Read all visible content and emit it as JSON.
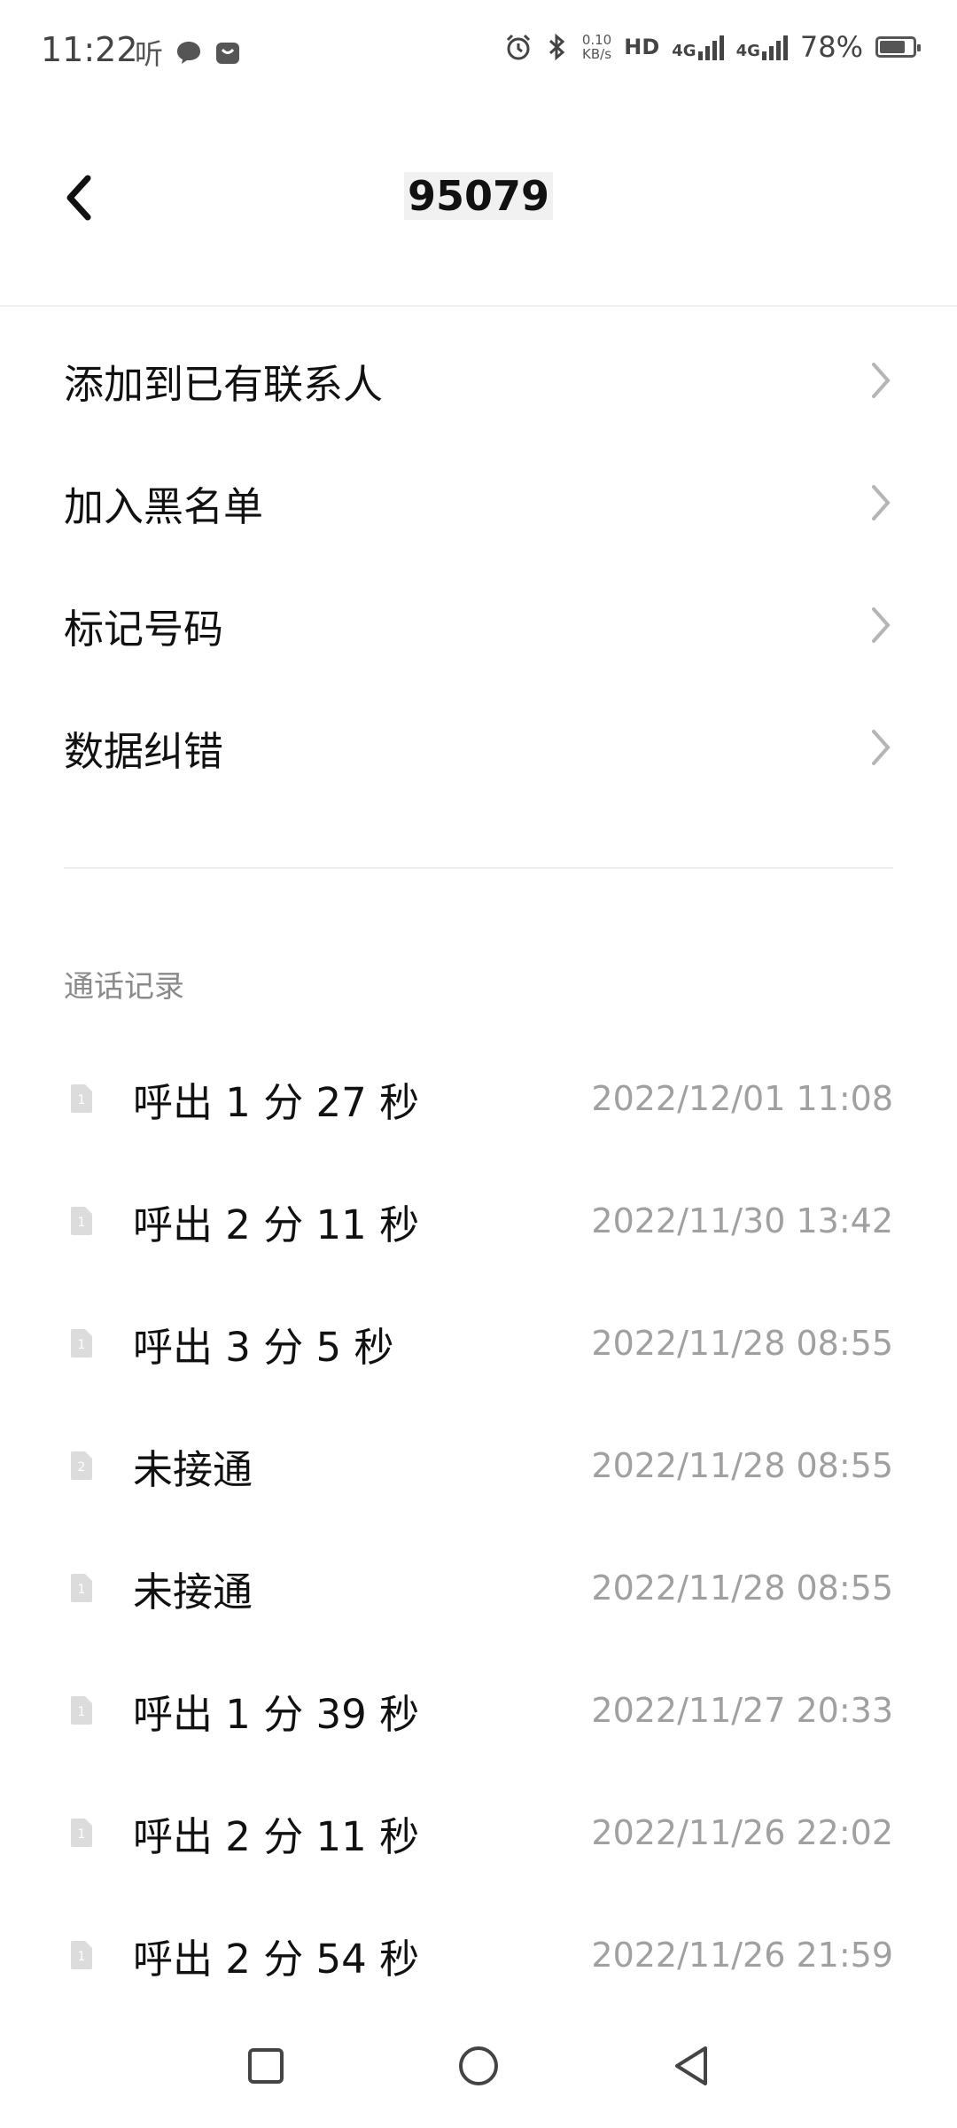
{
  "status_bar": {
    "time": "11:22",
    "listen_icon_text": "听",
    "net_speed_top": "0.10",
    "net_speed_bottom": "KB/s",
    "hd_label": "HD",
    "sim1_label": "4G",
    "sim2_label": "4G",
    "battery_text": "78%",
    "battery_level": 0.78
  },
  "header": {
    "title": "95079"
  },
  "menu": [
    {
      "label": "添加到已有联系人"
    },
    {
      "label": "加入黑名单"
    },
    {
      "label": "标记号码"
    },
    {
      "label": "数据纠错"
    }
  ],
  "call_log": {
    "title": "通话记录",
    "rows": [
      {
        "sim": "1",
        "label": "呼出 1 分 27 秒",
        "time": "2022/12/01 11:08"
      },
      {
        "sim": "1",
        "label": "呼出 2 分 11 秒",
        "time": "2022/11/30 13:42"
      },
      {
        "sim": "1",
        "label": "呼出 3 分 5 秒",
        "time": "2022/11/28 08:55"
      },
      {
        "sim": "2",
        "label": "未接通",
        "time": "2022/11/28 08:55"
      },
      {
        "sim": "1",
        "label": "未接通",
        "time": "2022/11/28 08:55"
      },
      {
        "sim": "1",
        "label": "呼出 1 分 39 秒",
        "time": "2022/11/27 20:33"
      },
      {
        "sim": "1",
        "label": "呼出 2 分 11 秒",
        "time": "2022/11/26 22:02"
      },
      {
        "sim": "1",
        "label": "呼出 2 分 54 秒",
        "time": "2022/11/26 21:59"
      }
    ]
  },
  "colors": {
    "text_primary": "#111111",
    "text_secondary": "#8a8a8a",
    "time_text": "#a0a0a0",
    "divider": "#eeeeee"
  },
  "icons": {
    "back": "chevron-left-icon",
    "menu_arrow": "chevron-right-icon",
    "sim": "sim-card-icon",
    "nav_recent": "square-icon",
    "nav_home": "circle-icon",
    "nav_back": "triangle-back-icon"
  }
}
